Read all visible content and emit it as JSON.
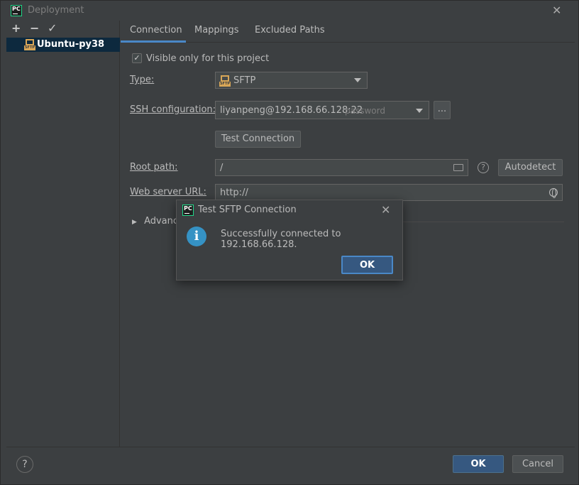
{
  "window": {
    "title": "Deployment"
  },
  "sidebar": {
    "toolbar": {
      "add": "+",
      "remove": "−",
      "apply": "✓"
    },
    "servers": [
      {
        "label": "Ubuntu-py38",
        "icon": "sftp-server-icon"
      }
    ]
  },
  "tabs": [
    {
      "label": "Connection",
      "active": true
    },
    {
      "label": "Mappings",
      "active": false
    },
    {
      "label": "Excluded Paths",
      "active": false
    }
  ],
  "connection": {
    "visible_only_label": "Visible only for this project",
    "visible_only_checked": true,
    "type_label": "Type:",
    "type_value": "SFTP",
    "ssh_label": "SSH configuration:",
    "ssh_value": "liyanpeng@192.168.66.128:22",
    "ssh_hint": "password",
    "ssh_more": "...",
    "test_button": "Test Connection",
    "root_label": "Root path:",
    "root_value": "/",
    "help_mark": "?",
    "autodetect_button": "Autodetect",
    "web_label": "Web server URL:",
    "web_value": "http://",
    "advanced_label": "Advanced"
  },
  "footer": {
    "help": "?",
    "ok": "OK",
    "cancel": "Cancel"
  },
  "dialog": {
    "title": "Test SFTP Connection",
    "message": "Successfully connected to 192.168.66.128.",
    "ok": "OK"
  },
  "colors": {
    "accent": "#4a88c7",
    "primary_button": "#365880",
    "info": "#3592c4",
    "sftp_icon": "#d8a657"
  }
}
